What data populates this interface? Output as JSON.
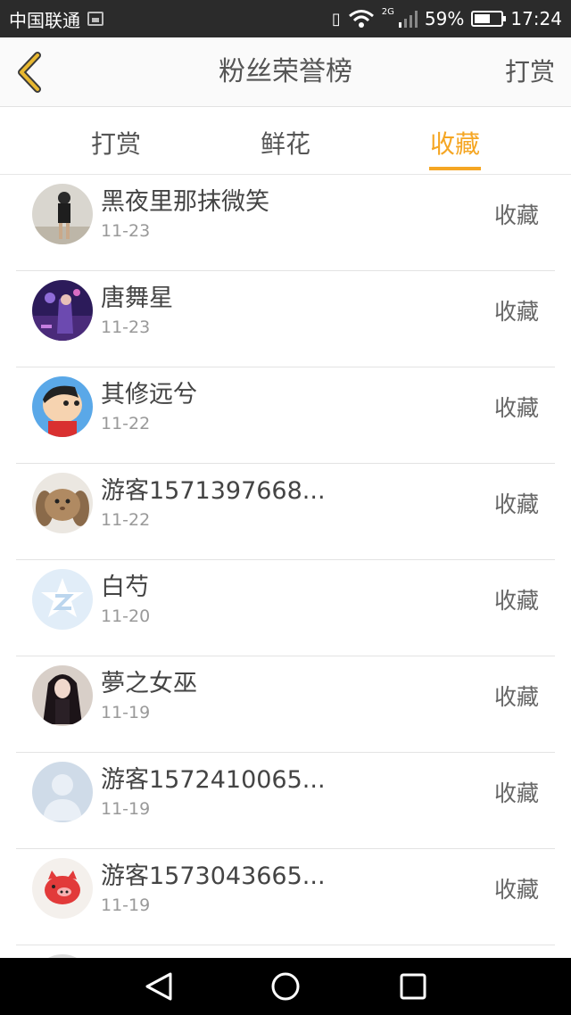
{
  "status_bar": {
    "carrier": "中国联通",
    "network": "2G",
    "battery": "59%",
    "battery_level": 0.59,
    "time": "17:24"
  },
  "header": {
    "title": "粉丝荣誉榜",
    "action": "打赏"
  },
  "tabs": [
    {
      "label": "打赏",
      "active": false
    },
    {
      "label": "鲜花",
      "active": false
    },
    {
      "label": "收藏",
      "active": true
    }
  ],
  "list": [
    {
      "name": "黑夜里那抹微笑",
      "date": "11-23",
      "type": "收藏",
      "avatar": "photo-avatar"
    },
    {
      "name": "唐舞星",
      "date": "11-23",
      "type": "收藏",
      "avatar": "anime-avatar"
    },
    {
      "name": "其修远兮",
      "date": "11-22",
      "type": "收藏",
      "avatar": "cartoon-avatar"
    },
    {
      "name": "游客1571397668...",
      "date": "11-22",
      "type": "收藏",
      "avatar": "rabbit-avatar"
    },
    {
      "name": "白芍",
      "date": "11-20",
      "type": "收藏",
      "avatar": "default-z-avatar"
    },
    {
      "name": "夢之女巫",
      "date": "11-19",
      "type": "收藏",
      "avatar": "anime-girl-avatar"
    },
    {
      "name": "游客1572410065...",
      "date": "11-19",
      "type": "收藏",
      "avatar": "default-person-avatar"
    },
    {
      "name": "游客1573043665...",
      "date": "11-19",
      "type": "收藏",
      "avatar": "pig-avatar"
    }
  ],
  "colors": {
    "accent": "#f5a623",
    "status_bar_bg": "#2b2b2b",
    "nav_bar_bg": "#000000"
  }
}
